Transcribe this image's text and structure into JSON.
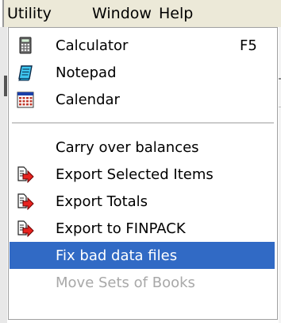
{
  "menubar": {
    "items": [
      {
        "label": "Utility"
      },
      {
        "label": "Window"
      },
      {
        "label": "Help"
      }
    ]
  },
  "menu": {
    "items": [
      {
        "label": "Calculator",
        "shortcut": "F5",
        "icon": "calculator-icon"
      },
      {
        "label": "Notepad",
        "icon": "notepad-icon"
      },
      {
        "label": "Calendar",
        "icon": "calendar-icon"
      },
      {
        "label": "Carry over balances"
      },
      {
        "label": "Export Selected Items",
        "icon": "export-arrow-icon"
      },
      {
        "label": "Export Totals",
        "icon": "export-arrow-icon"
      },
      {
        "label": "Export to FINPACK",
        "icon": "export-arrow-icon"
      },
      {
        "label": "Fix bad data files",
        "highlighted": true
      },
      {
        "label": "Move Sets of Books",
        "disabled": true
      }
    ]
  },
  "colors": {
    "highlight": "#316ac5",
    "menubar_bg": "#ece9d8",
    "disabled_text": "#a8a8a8",
    "export_arrow": "#e8231f"
  }
}
